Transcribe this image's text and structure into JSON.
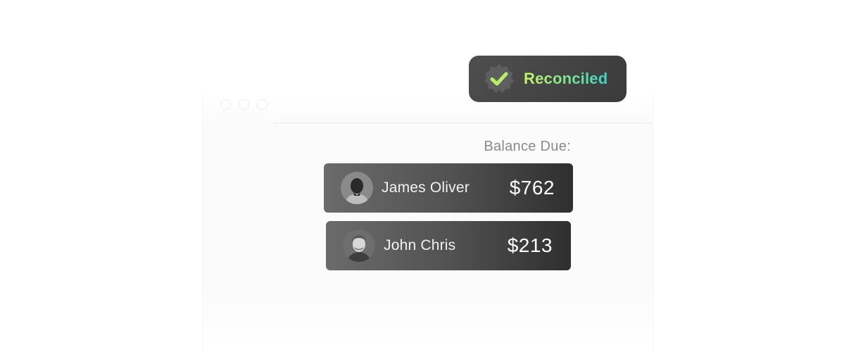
{
  "badge": {
    "label": "Reconciled",
    "icon": "verified-check-icon",
    "colors": {
      "background": "#454545",
      "gradient_start": "#c6f46a",
      "gradient_end": "#3fd3c4"
    }
  },
  "balance": {
    "label": "Balance Due:",
    "payees": [
      {
        "name": "James Oliver",
        "amount": "$762",
        "avatar": "avatar-photo"
      },
      {
        "name": "John Chris",
        "amount": "$213",
        "avatar": "avatar-photo"
      }
    ]
  }
}
